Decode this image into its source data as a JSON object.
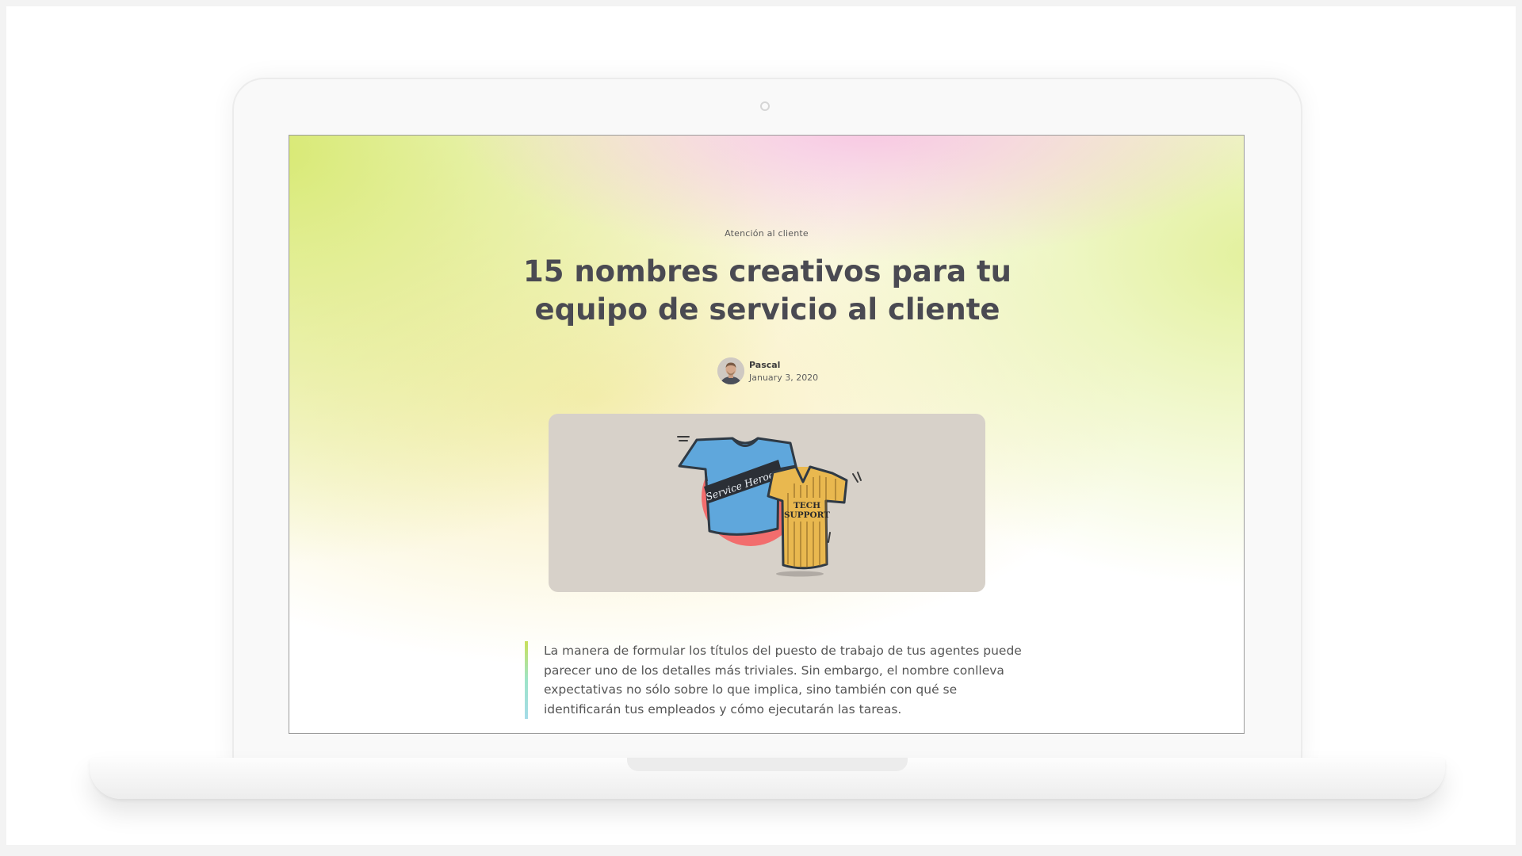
{
  "article": {
    "category": "Atención al cliente",
    "title": "15 nombres creativos para tu equipo de servicio al cliente",
    "author": {
      "name": "Pascal",
      "date": "January 3, 2020"
    },
    "hero_image": {
      "shirt_left_text": "Service Heroes",
      "shirt_right_text_line1": "TECH",
      "shirt_right_text_line2": "SUPPORT"
    },
    "intro": "La manera de formular los títulos del puesto de trabajo de tus agentes puede parecer uno de los detalles más triviales. Sin embargo, el nombre conlleva expectativas no sólo sobre lo que implica, sino también con qué se identificarán tus empleados y cómo ejecutarán las tareas."
  },
  "colors": {
    "title_text": "#4a4a52",
    "hero_background": "#d7d1c9",
    "shirt_blue": "#5fa7dc",
    "shirt_yellow": "#e9b84f",
    "circle_red": "#f26d6d",
    "quote_bar_top": "#c9e05a",
    "quote_bar_bottom": "#a4dbe8"
  }
}
